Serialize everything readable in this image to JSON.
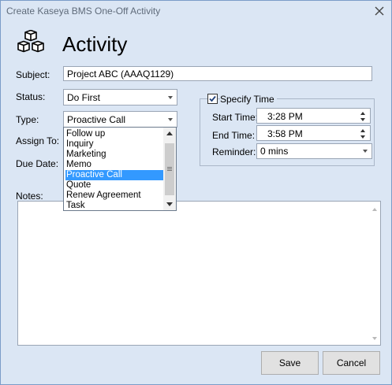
{
  "window": {
    "title": "Create Kaseya BMS One-Off Activity"
  },
  "heading": "Activity",
  "labels": {
    "subject": "Subject:",
    "status": "Status:",
    "type": "Type:",
    "assign_to": "Assign To:",
    "due_date": "Due Date:",
    "notes": "Notes:"
  },
  "subject_value": "Project ABC (AAAQ1129)",
  "status_value": "Do First",
  "type_value": "Proactive Call",
  "type_options": [
    "Follow up",
    "Inquiry",
    "Marketing",
    "Memo",
    "Proactive Call",
    "Quote",
    "Renew Agreement",
    "Task"
  ],
  "type_selected_index": 4,
  "specify_time": {
    "label": "Specify Time",
    "checked": true,
    "start_label": "Start Time:",
    "start_value": "3:28 PM",
    "end_label": "End Time:",
    "end_value": "3:58 PM",
    "reminder_label": "Reminder:",
    "reminder_value": "0 mins"
  },
  "buttons": {
    "save": "Save",
    "cancel": "Cancel"
  },
  "colors": {
    "background": "#dbe6f4",
    "selection": "#3399ff"
  },
  "icons": {
    "logo": "cubes-icon",
    "close": "close-icon"
  }
}
